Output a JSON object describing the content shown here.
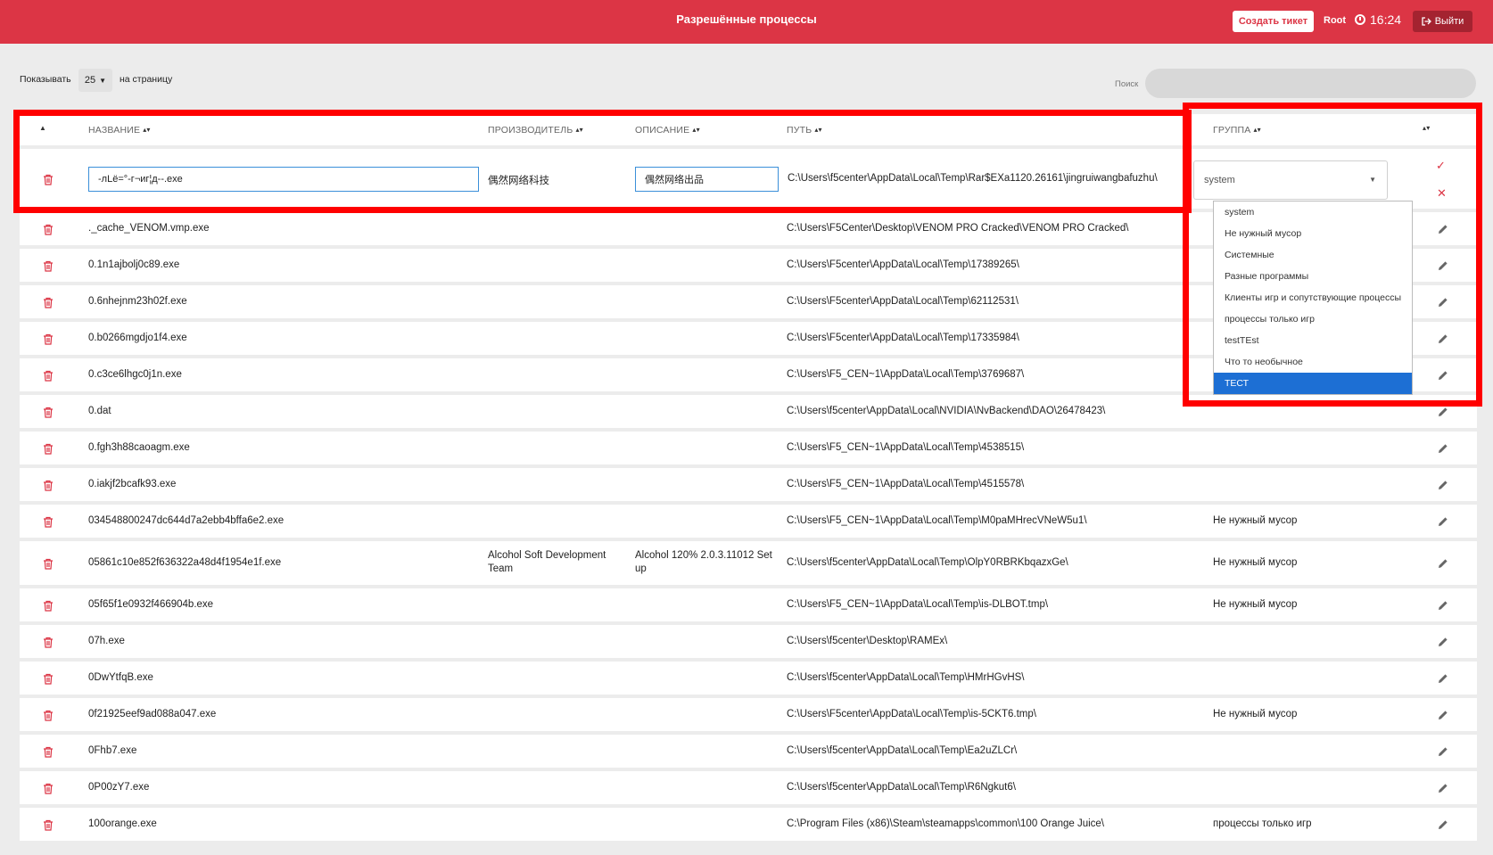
{
  "header": {
    "title": "Разрешённые процессы",
    "ticket_button": "Создать тикет",
    "user": "Root",
    "time": "16:24",
    "logout_button": "Выйти"
  },
  "pagination": {
    "show_label": "Показывать",
    "per_page": "25",
    "per_page_suffix": "на страницу"
  },
  "search": {
    "label": "Поиск",
    "placeholder": ""
  },
  "columns": {
    "name": "НАЗВАНИЕ",
    "vendor": "ПРОИЗВОДИТЕЛЬ",
    "description": "ОПИСАНИЕ",
    "path": "ПУТЬ",
    "group": "ГРУППА"
  },
  "edit_row": {
    "name": "-лLё=°-г¬иг¦д--.exe",
    "vendor": "偶然网络科技",
    "description": "偶然网络出品",
    "path": "C:\\Users\\f5center\\AppData\\Local\\Temp\\Rar$EXa1120.26161\\jingruiwangbafuzhu\\",
    "group": "system"
  },
  "group_options": [
    "system",
    "Не нужный мусор",
    "Системные",
    "Разные программы",
    "Клиенты игр и сопутствующие процессы",
    "процессы только игр",
    "testTEst",
    "Что то необычное",
    "ТЕСТ"
  ],
  "selected_group_option": "ТЕСТ",
  "rows": [
    {
      "name": "._cache_VENOM.vmp.exe",
      "vendor": "",
      "description": "",
      "path": "C:\\Users\\F5Center\\Desktop\\VENOM PRO Cracked\\VENOM PRO Cracked\\",
      "group": ""
    },
    {
      "name": "0.1n1ajbolj0c89.exe",
      "vendor": "",
      "description": "",
      "path": "C:\\Users\\F5center\\AppData\\Local\\Temp\\17389265\\",
      "group": ""
    },
    {
      "name": "0.6nhejnm23h02f.exe",
      "vendor": "",
      "description": "",
      "path": "C:\\Users\\F5center\\AppData\\Local\\Temp\\62112531\\",
      "group": ""
    },
    {
      "name": "0.b0266mgdjo1f4.exe",
      "vendor": "",
      "description": "",
      "path": "C:\\Users\\F5center\\AppData\\Local\\Temp\\17335984\\",
      "group": ""
    },
    {
      "name": "0.c3ce6lhgc0j1n.exe",
      "vendor": "",
      "description": "",
      "path": "C:\\Users\\F5_CEN~1\\AppData\\Local\\Temp\\3769687\\",
      "group": ""
    },
    {
      "name": "0.dat",
      "vendor": "",
      "description": "",
      "path": "C:\\Users\\f5center\\AppData\\Local\\NVIDIA\\NvBackend\\DAO\\26478423\\",
      "group": ""
    },
    {
      "name": "0.fgh3h88caoagm.exe",
      "vendor": "",
      "description": "",
      "path": "C:\\Users\\F5_CEN~1\\AppData\\Local\\Temp\\4538515\\",
      "group": ""
    },
    {
      "name": "0.iakjf2bcafk93.exe",
      "vendor": "",
      "description": "",
      "path": "C:\\Users\\F5_CEN~1\\AppData\\Local\\Temp\\4515578\\",
      "group": ""
    },
    {
      "name": "034548800247dc644d7a2ebb4bffa6e2.exe",
      "vendor": "",
      "description": "",
      "path": "C:\\Users\\F5_CEN~1\\AppData\\Local\\Temp\\M0paMHrecVNeW5u1\\",
      "group": "Не нужный мусор"
    },
    {
      "name": "05861c10e852f636322a48d4f1954e1f.exe",
      "vendor": "Alcohol Soft Development Team",
      "description": "Alcohol 120% 2.0.3.11012 Set up",
      "path": "C:\\Users\\f5center\\AppData\\Local\\Temp\\OlpY0RBRKbqazxGe\\",
      "group": "Не нужный мусор"
    },
    {
      "name": "05f65f1e0932f466904b.exe",
      "vendor": "",
      "description": "",
      "path": "C:\\Users\\F5_CEN~1\\AppData\\Local\\Temp\\is-DLBOT.tmp\\",
      "group": "Не нужный мусор"
    },
    {
      "name": "07h.exe",
      "vendor": "",
      "description": "",
      "path": "C:\\Users\\f5center\\Desktop\\RAMEx\\",
      "group": ""
    },
    {
      "name": "0DwYtfqB.exe",
      "vendor": "",
      "description": "",
      "path": "C:\\Users\\f5center\\AppData\\Local\\Temp\\HMrHGvHS\\",
      "group": ""
    },
    {
      "name": "0f21925eef9ad088a047.exe",
      "vendor": "",
      "description": "",
      "path": "C:\\Users\\F5center\\AppData\\Local\\Temp\\is-5CKT6.tmp\\",
      "group": "Не нужный мусор"
    },
    {
      "name": "0Fhb7.exe",
      "vendor": "",
      "description": "",
      "path": "C:\\Users\\f5center\\AppData\\Local\\Temp\\Ea2uZLCr\\",
      "group": ""
    },
    {
      "name": "0P00zY7.exe",
      "vendor": "",
      "description": "",
      "path": "C:\\Users\\f5center\\AppData\\Local\\Temp\\R6Ngkut6\\",
      "group": ""
    },
    {
      "name": "100orange.exe",
      "vendor": "",
      "description": "",
      "path": "C:\\Program Files (x86)\\Steam\\steamapps\\common\\100 Orange Juice\\",
      "group": "процессы только игр"
    }
  ]
}
